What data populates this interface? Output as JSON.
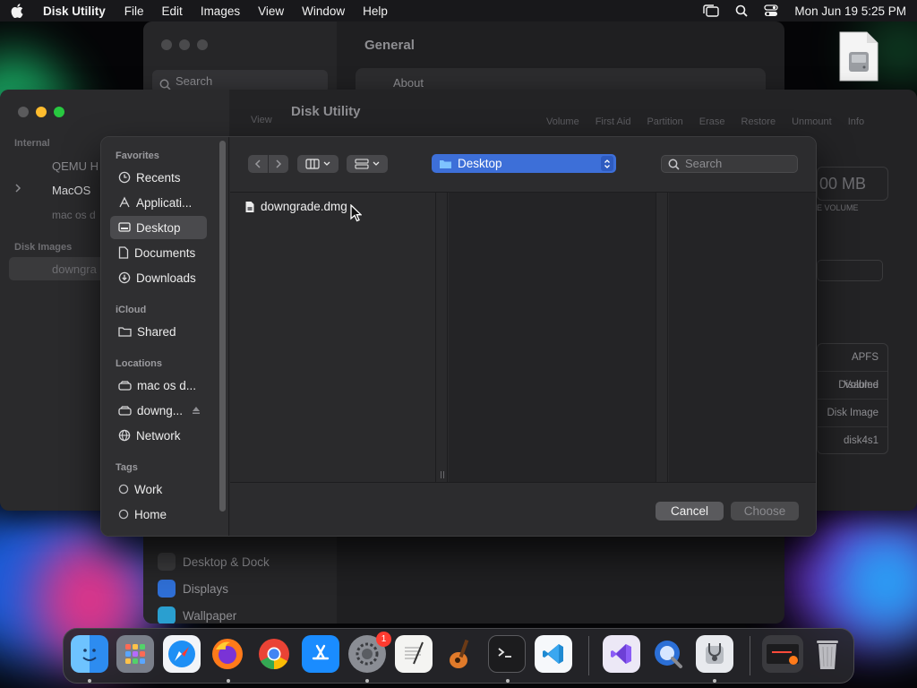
{
  "menubar": {
    "app_name": "Disk Utility",
    "items": [
      "File",
      "Edit",
      "Images",
      "View",
      "Window",
      "Help"
    ],
    "clock": "Mon Jun 19  5:25 PM"
  },
  "settings_window": {
    "search_placeholder": "Search",
    "title": "General",
    "about_label": "About",
    "items": [
      "Desktop & Dock",
      "Displays",
      "Wallpaper"
    ]
  },
  "disk_utility": {
    "title": "Disk Utility",
    "toolbar": [
      "Volume",
      "First Aid",
      "Partition",
      "Erase",
      "Restore",
      "Unmount",
      "Info"
    ],
    "view_label": "View",
    "sidebar": {
      "internal_header": "Internal",
      "internal_items": [
        "QEMU H",
        "MacOS",
        "mac os d"
      ],
      "images_header": "Disk Images",
      "image_items": [
        "downgra"
      ]
    },
    "size_value": "00 MB",
    "size_caption": "E VOLUME",
    "info_rows": [
      "APFS Volume",
      "Disabled",
      "Disk Image",
      "disk4s1"
    ]
  },
  "dialog": {
    "sidebar": {
      "favorites_header": "Favorites",
      "favorites": [
        "Recents",
        "Applicati...",
        "Desktop",
        "Documents",
        "Downloads"
      ],
      "icloud_header": "iCloud",
      "icloud": [
        "Shared"
      ],
      "locations_header": "Locations",
      "locations": [
        "mac os d...",
        "downg...",
        "Network"
      ],
      "tags_header": "Tags",
      "tags": [
        "Work",
        "Home"
      ],
      "selected": "Desktop"
    },
    "location": "Desktop",
    "search_placeholder": "Search",
    "files": [
      "downgrade.dmg"
    ],
    "cancel_label": "Cancel",
    "choose_label": "Choose"
  },
  "dock": {
    "apps": [
      "Finder",
      "Launchpad",
      "Safari",
      "Firefox",
      "Chrome",
      "App Store",
      "System Settings",
      "TextEdit",
      "GarageBand",
      "Terminal",
      "Visual Studio Code",
      "Visual Studio",
      "QuickTime Player",
      "Disk Utility",
      "Downloads",
      "Trash"
    ],
    "settings_badge": "1"
  },
  "colors": {
    "accent": "#3d6fd8",
    "traffic_red": "#ff5f57",
    "traffic_yellow": "#febc2e",
    "traffic_green": "#28c840"
  }
}
